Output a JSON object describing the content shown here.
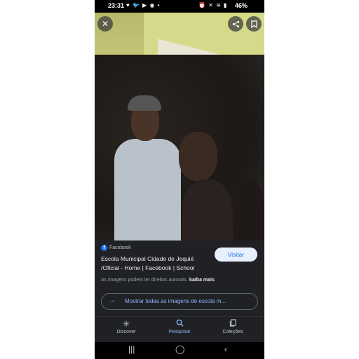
{
  "status_bar": {
    "time": "23:31",
    "left_icons": "♥ 🐦 ▶ ◉ •",
    "right_icons": "⏰ ✕ ≋ ▮",
    "battery": "46%"
  },
  "photo_actions": {
    "close_icon": "close-icon",
    "share_icon": "share-icon",
    "save_icon": "bookmark-icon"
  },
  "result": {
    "source": "Facebook",
    "title": "Escola Municipal Cidade de Jequié /Oficial - Home | Facebook | School",
    "visit_label": "Visitar",
    "rights_text": "As imagens podem ter direitos autorais.",
    "rights_link": "Saiba mais",
    "show_all_label": "Mostrar todas as imagens de escola m..."
  },
  "bottom_nav": {
    "items": [
      {
        "label": "Discover",
        "icon": "asterisk-icon"
      },
      {
        "label": "Pesquisar",
        "icon": "search-icon"
      },
      {
        "label": "Coleções",
        "icon": "collections-icon"
      }
    ],
    "active": "Pesquisar"
  },
  "colors": {
    "accent": "#8ab4f8",
    "visit_bg": "#e8f0fe",
    "visit_text": "#1a73e8",
    "panel_bg": "#202124",
    "facebook": "#1877f2"
  }
}
